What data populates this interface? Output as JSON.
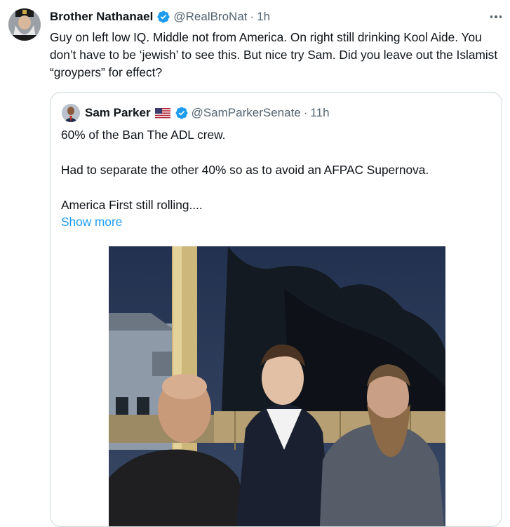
{
  "tweet": {
    "author_name": "Brother Nathanael",
    "handle": "@RealBroNat",
    "separator": "·",
    "time": "1h",
    "text": "Guy on left low IQ. Middle not from America. On right still drinking Kool Aide. You don’t have to be ‘jewish’ to see this. But nice try Sam. Did you leave out the Islamist “groypers” for effect?",
    "verified_color": "#1d9bf0"
  },
  "quote": {
    "author_name": "Sam Parker",
    "flag_icon": "us-flag-icon",
    "handle": "@SamParkerSenate",
    "separator": "·",
    "time": "11h",
    "lines": [
      "60% of the Ban The ADL crew.",
      "",
      "Had to separate the other 40% so as to avoid an AFPAC Supernova.",
      "",
      "America First still rolling...."
    ],
    "show_more": "Show more"
  },
  "colors": {
    "link": "#1d9bf0",
    "secondary_text": "#536471",
    "border": "#cfd9de"
  }
}
